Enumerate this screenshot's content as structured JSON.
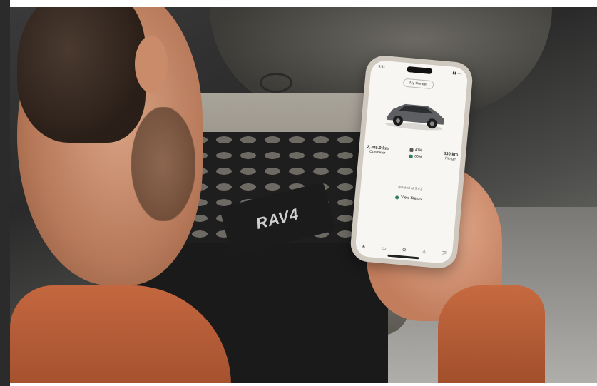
{
  "image": {
    "license_plate": "RAV4"
  },
  "phone_app": {
    "status_time": "9:41",
    "vehicle_selector": "My Garage",
    "odometer_value": "2,385.0 km",
    "odometer_label": "Odometer",
    "fuel_percent": "41%",
    "battery_percent": "60%",
    "range_value": "830 km",
    "range_label": "Range",
    "updated_text": "Updated at 9:41",
    "status_button": "View Status",
    "nav_icons": [
      "car-icon",
      "map-icon",
      "gear-icon",
      "person-icon",
      "menu-icon"
    ],
    "accent_color": "#2e7d5b"
  }
}
